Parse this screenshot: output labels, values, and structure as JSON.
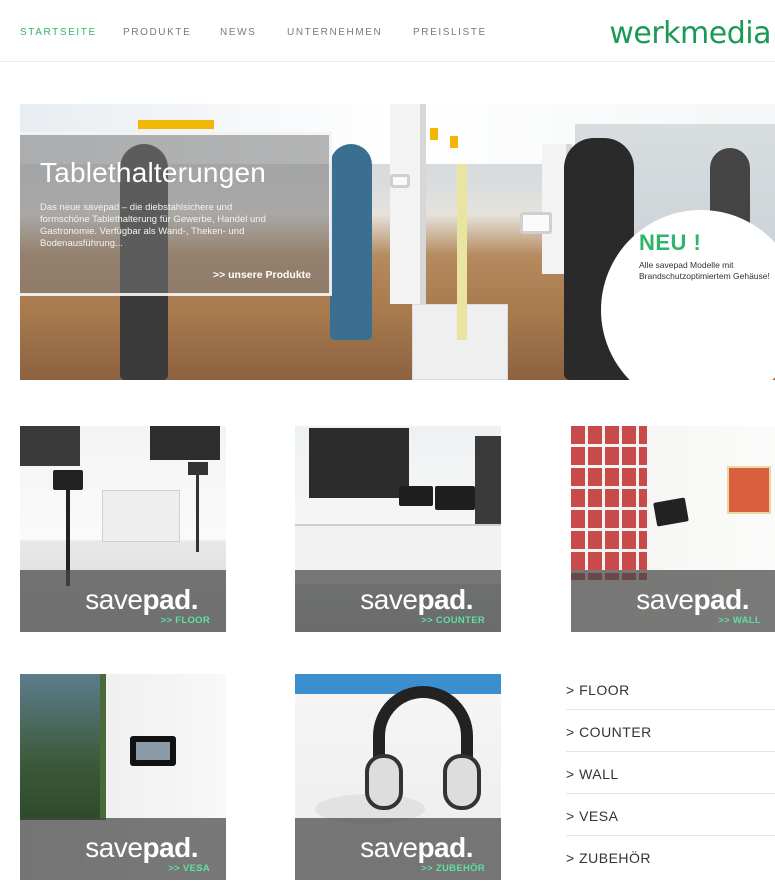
{
  "nav": {
    "items": [
      {
        "label": "STARTSEITE",
        "active": true
      },
      {
        "label": "PRODUKTE",
        "active": false
      },
      {
        "label": "NEWS",
        "active": false
      },
      {
        "label": "UNTERNEHMEN",
        "active": false
      },
      {
        "label": "PREISLISTE",
        "active": false
      }
    ],
    "logo": "werkmedia"
  },
  "hero": {
    "title": "Tablethalterungen",
    "text": "Das neue savepad – die diebstahlsichere und formschöne Tablethalterung für Gewerbe, Handel und Gastronomie. Verfügbar als Wand-, Theken- und Bodenausführung...",
    "link": ">> unsere Produkte",
    "badge": {
      "title": "NEU !",
      "text": "Alle savepad Modelle mit Brandschutzoptimiertem Gehäuse!"
    }
  },
  "tiles": [
    {
      "brand_a": "save",
      "brand_b": "pad.",
      "sub": ">> FLOOR"
    },
    {
      "brand_a": "save",
      "brand_b": "pad.",
      "sub": ">> COUNTER"
    },
    {
      "brand_a": "save",
      "brand_b": "pad.",
      "sub": ">> WALL"
    },
    {
      "brand_a": "save",
      "brand_b": "pad.",
      "sub": ">> VESA"
    },
    {
      "brand_a": "save",
      "brand_b": "pad.",
      "sub": ">> ZUBEHÖR"
    }
  ],
  "links": [
    {
      "label": "> FLOOR"
    },
    {
      "label": "> COUNTER"
    },
    {
      "label": "> WALL"
    },
    {
      "label": "> VESA"
    },
    {
      "label": "> ZUBEHÖR"
    }
  ],
  "colors": {
    "accent": "#2fb56a",
    "logo": "#1b9a55",
    "tile_sub": "#5fe0a1"
  }
}
